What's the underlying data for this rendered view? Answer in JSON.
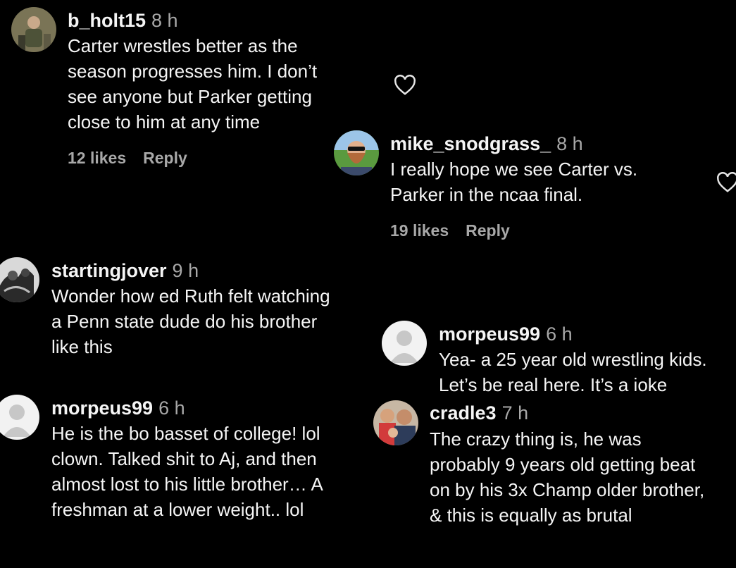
{
  "colors": {
    "background": "#000000",
    "text": "#f5f5f5",
    "muted": "#a8a8a8"
  },
  "comments": [
    {
      "username": "b_holt15",
      "time": "8 h",
      "lines": [
        "Carter wrestles better as the",
        "season progresses him. I don’t",
        "see anyone but Parker getting",
        "close to him at any time"
      ],
      "likes": "12 likes",
      "reply": "Reply",
      "avatar": "photo"
    },
    {
      "username": "mike_snodgrass_",
      "time": "8 h",
      "lines": [
        "I really hope we see Carter vs.",
        "Parker in the ncaa final."
      ],
      "likes": "19 likes",
      "reply": "Reply",
      "avatar": "photo"
    },
    {
      "username": "startingjover",
      "time": "9 h",
      "lines": [
        "Wonder how ed Ruth felt watching",
        "a Penn state dude do his brother",
        "like this"
      ],
      "avatar": "photo"
    },
    {
      "username": "morpeus99",
      "time": "6 h",
      "lines": [
        "Yea- a 25 year old wrestling kids.",
        "Let’s be real here. It’s a ioke"
      ],
      "avatar": "default"
    },
    {
      "username": "morpeus99",
      "time": "6 h",
      "lines": [
        "He is the bo basset of college! lol",
        "clown. Talked shit to Aj, and then",
        "almost lost to his little brother… A",
        "freshman at a lower weight.. lol"
      ],
      "avatar": "default"
    },
    {
      "username": "cradle3",
      "time": "7 h",
      "lines": [
        "The crazy thing is, he was",
        "probably 9 years old getting beat",
        "on by his 3x Champ older brother,",
        "& this is equally as brutal"
      ],
      "avatar": "photo"
    }
  ]
}
